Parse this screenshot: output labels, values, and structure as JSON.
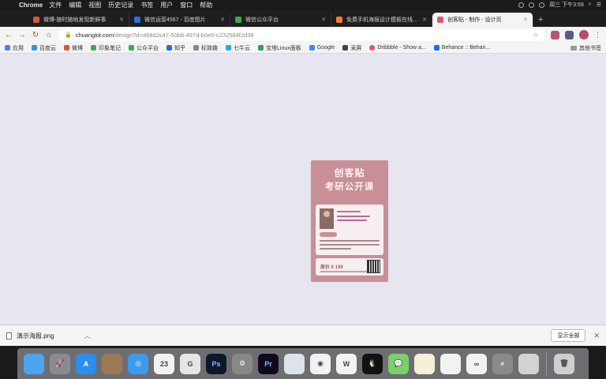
{
  "menubar": {
    "app_name": "Chrome",
    "items": [
      "文件",
      "编辑",
      "视图",
      "历史记录",
      "书签",
      "用户",
      "窗口",
      "帮助"
    ],
    "clock": "周三 下午3:59"
  },
  "tabs": [
    {
      "title": "微博-随时随地发现新鲜事",
      "color": "#e0533a"
    },
    {
      "title": "微信运营4567 - 百度图片",
      "color": "#2a6ee0"
    },
    {
      "title": "微信公众平台",
      "color": "#34b050"
    },
    {
      "title": "免费手机海报设计模板在线编辑",
      "color": "#ff7a2a"
    },
    {
      "title": "创客贴 - 制作 - 设计页",
      "color": "#e05570"
    }
  ],
  "toolbar": {
    "url_host": "chuangkit.com",
    "url_path": "/design?d=a58d2c47-50bb-497d-b0e0-c232584f2d38"
  },
  "bookmarks": {
    "items": [
      {
        "label": "应用",
        "color": "#5b7fd9"
      },
      {
        "label": "百度云",
        "color": "#3a8ee6"
      },
      {
        "label": "微博",
        "color": "#e0533a"
      },
      {
        "label": "印象笔记",
        "color": "#34b050"
      },
      {
        "label": "公众平台",
        "color": "#34b050"
      },
      {
        "label": "知乎",
        "color": "#1e6fd9"
      },
      {
        "label": "标致趣",
        "color": "#888888"
      },
      {
        "label": "七牛云",
        "color": "#27aee0"
      },
      {
        "label": "宝塔Linux面板",
        "color": "#30a050"
      },
      {
        "label": "Google",
        "color": "#4285f4"
      },
      {
        "label": "采屏",
        "color": "#444444"
      },
      {
        "label": "Dribbble - Show a...",
        "color": "#ea4c89"
      },
      {
        "label": "Behance :: Behan...",
        "color": "#1769ff"
      }
    ],
    "other": "其他书签"
  },
  "poster": {
    "title_line1": "创客贴",
    "title_line2": "考研公开课",
    "price": "原价 ¥ 199"
  },
  "download": {
    "filename": "演示海报.png",
    "show_all": "显示全部"
  },
  "dock": {
    "apps": [
      {
        "name": "finder-icon",
        "color": "#4ea3f1",
        "glyph": ""
      },
      {
        "name": "launchpad-icon",
        "color": "#8a8a92",
        "glyph": "🚀"
      },
      {
        "name": "app-store-icon",
        "color": "#2b8ef2",
        "glyph": "A"
      },
      {
        "name": "photos-viewer-icon",
        "color": "#9c7a56",
        "glyph": ""
      },
      {
        "name": "safari-icon",
        "color": "#3a9bef",
        "glyph": "◎"
      },
      {
        "name": "calendar-icon",
        "color": "#f2f2f2",
        "glyph": "23"
      },
      {
        "name": "qq-browser-icon",
        "color": "#e6e6e6",
        "glyph": "G"
      },
      {
        "name": "photoshop-icon",
        "color": "#0a1a2a",
        "glyph": "Ps"
      },
      {
        "name": "system-preferences-icon",
        "color": "#888888",
        "glyph": "⚙"
      },
      {
        "name": "premiere-icon",
        "color": "#14081f",
        "glyph": "Pr"
      },
      {
        "name": "keynote-icon",
        "color": "#dde3ea",
        "glyph": ""
      },
      {
        "name": "chrome-icon",
        "color": "#f2f2f2",
        "glyph": "◉"
      },
      {
        "name": "wps-icon",
        "color": "#f2f2f2",
        "glyph": "W"
      },
      {
        "name": "qq-icon",
        "color": "#111111",
        "glyph": "🐧"
      },
      {
        "name": "wechat-icon",
        "color": "#7ad06a",
        "glyph": "💬"
      },
      {
        "name": "notes-icon",
        "color": "#f6f0d8",
        "glyph": ""
      },
      {
        "name": "preview-icon",
        "color": "#f2f2f2",
        "glyph": ""
      },
      {
        "name": "baidu-netdisk-icon",
        "color": "#f2f2f2",
        "glyph": "∞"
      },
      {
        "name": "screen-capture-icon",
        "color": "#8a8a8a",
        "glyph": "⌕"
      },
      {
        "name": "quicktime-icon",
        "color": "#d2d2d2",
        "glyph": ""
      },
      {
        "name": "trash-icon",
        "color": "#cfcfcf",
        "glyph": "🗑"
      }
    ]
  }
}
